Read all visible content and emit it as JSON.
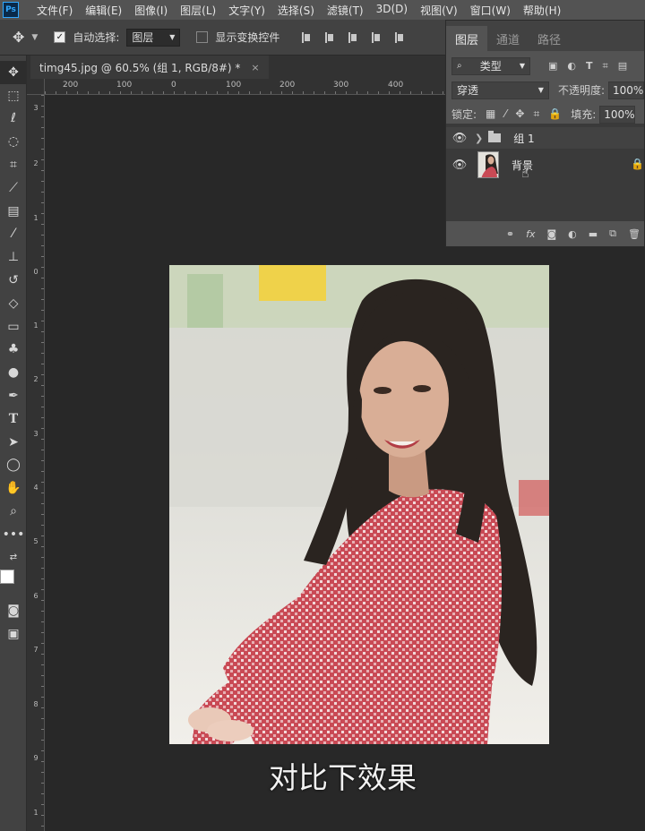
{
  "menu": {
    "logo": "Ps",
    "items": [
      "文件(F)",
      "编辑(E)",
      "图像(I)",
      "图层(L)",
      "文字(Y)",
      "选择(S)",
      "滤镜(T)",
      "3D(D)",
      "视图(V)",
      "窗口(W)",
      "帮助(H)"
    ]
  },
  "options": {
    "auto_select_label": "自动选择:",
    "auto_select_checked": true,
    "target_value": "图层",
    "show_transform_label": "显示变换控件",
    "show_transform_checked": false
  },
  "document": {
    "tab_title": "timg45.jpg @ 60.5% (组 1, RGB/8#) *",
    "close": "×"
  },
  "rulers": {
    "top_labels": [
      "200",
      "100",
      "0",
      "100",
      "200",
      "300",
      "400"
    ],
    "left_labels": [
      "3",
      "2",
      "1",
      "0",
      "1",
      "2",
      "3",
      "4",
      "5",
      "6",
      "7",
      "8",
      "9",
      "1"
    ]
  },
  "tools": [
    "move-tool",
    "marquee-tool",
    "lasso-tool",
    "quick-select-tool",
    "crop-tool",
    "eyedropper-tool",
    "healing-tool",
    "brush-tool",
    "stamp-tool",
    "history-brush-tool",
    "eraser-tool",
    "gradient-tool",
    "blur-tool",
    "dodge-tool",
    "pen-tool",
    "type-tool",
    "path-select-tool",
    "shape-tool",
    "hand-tool",
    "zoom-tool",
    "more-tool"
  ],
  "layers_panel": {
    "tabs": [
      "图层",
      "通道",
      "路径"
    ],
    "active_tab": "图层",
    "filter_value": "类型",
    "blend_mode": "穿透",
    "opacity_label": "不透明度:",
    "opacity_value": "100%",
    "lock_label": "锁定:",
    "fill_label": "填充:",
    "fill_value": "100%",
    "layers": [
      {
        "name": "组 1",
        "type": "group",
        "visible": true
      },
      {
        "name": "背景",
        "type": "image",
        "visible": true,
        "locked": true
      }
    ]
  },
  "caption": "对比下效果",
  "colors": {
    "accent": "#31a8ff",
    "shirt_red": "#c94a55",
    "hair": "#2a2420"
  }
}
